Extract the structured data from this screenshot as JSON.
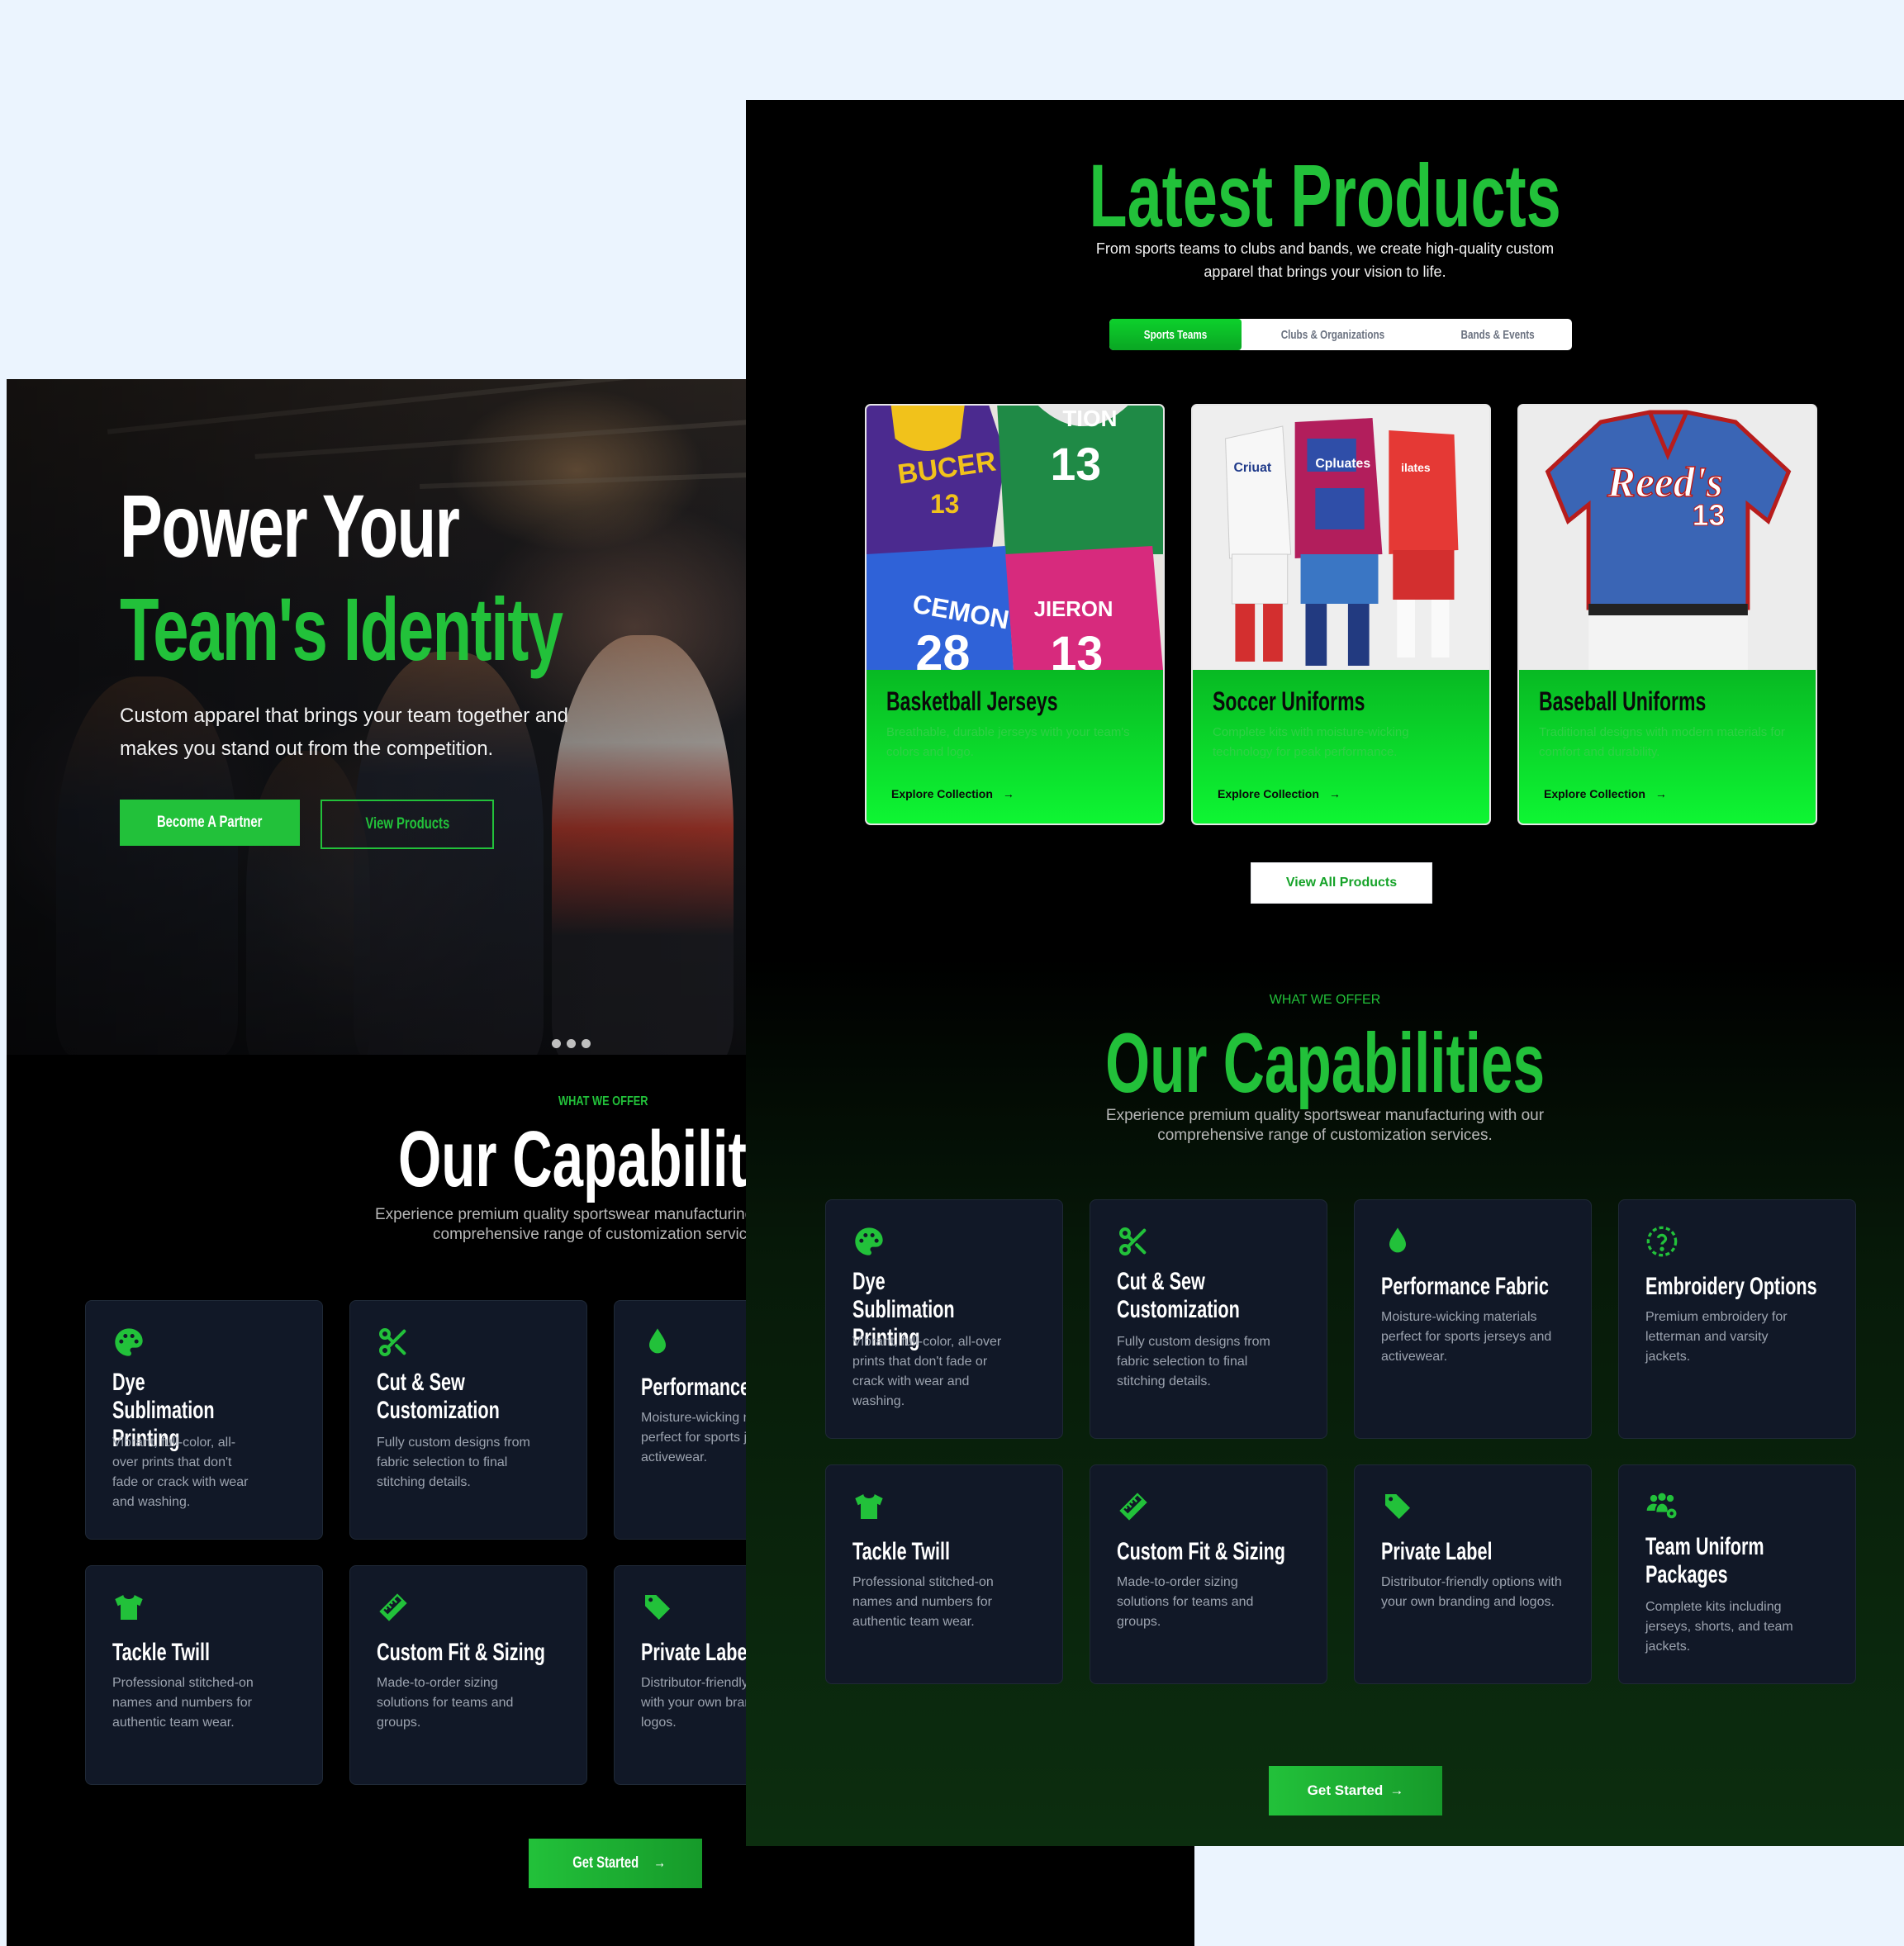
{
  "hero": {
    "title_line1": "Power Your",
    "title_line2": "Team's Identity",
    "subtitle": "Custom apparel that brings your team together and makes you stand out from the competition.",
    "primary_button": "Become A Partner",
    "secondary_button": "View Products",
    "carousel_dots": 3
  },
  "products": {
    "title": "Latest Products",
    "subtitle_line1": "From sports teams to clubs and bands, we create high-quality custom",
    "subtitle_line2": "apparel that brings your vision to life.",
    "tabs": [
      {
        "label": "Sports Teams",
        "active": true
      },
      {
        "label": "Clubs & Organizations",
        "active": false
      },
      {
        "label": "Bands & Events",
        "active": false
      }
    ],
    "cards": [
      {
        "title": "Basketball Jerseys",
        "desc": "Breathable, durable jerseys with your team's colors and logo.",
        "link": "Explore Collection"
      },
      {
        "title": "Soccer Uniforms",
        "desc": "Complete kits with moisture-wicking technology for peak performance.",
        "link": "Explore Collection"
      },
      {
        "title": "Baseball Uniforms",
        "desc": "Traditional designs with modern materials for comfort and durability.",
        "link": "Explore Collection"
      }
    ],
    "jersey_text": {
      "basketball": [
        "BUCER",
        "13",
        "TION",
        "13",
        "CEMON",
        "28",
        "JIERON",
        "13"
      ],
      "soccer": [
        "Criuat",
        "Cpluates",
        "ilates"
      ],
      "baseball": [
        "Reed's",
        "13"
      ]
    },
    "view_all": "View All Products"
  },
  "capabilities": {
    "eyebrow": "WHAT WE OFFER",
    "title": "Our Capabilities",
    "desc_line1": "Experience premium quality sportswear manufacturing with our",
    "desc_line2": "comprehensive range of customization services.",
    "items": [
      {
        "title": "Dye Sublimation Printing",
        "desc": "Vibrant, full-color, all-over prints that don't fade or crack with wear and washing.",
        "icon": "palette-icon"
      },
      {
        "title": "Cut & Sew Customization",
        "desc": "Fully custom designs from fabric selection to final stitching details.",
        "icon": "scissors-icon"
      },
      {
        "title": "Performance Fabric",
        "desc": "Moisture-wicking materials perfect for sports jerseys and activewear.",
        "icon": "droplet-icon"
      },
      {
        "title": "Embroidery Options",
        "desc": "Premium embroidery for letterman and varsity jackets.",
        "icon": "question-circle-icon"
      },
      {
        "title": "Tackle Twill",
        "desc": "Professional stitched-on names and numbers for authentic team wear.",
        "icon": "shirt-icon"
      },
      {
        "title": "Custom Fit & Sizing",
        "desc": "Made-to-order sizing solutions for teams and groups.",
        "icon": "ruler-icon"
      },
      {
        "title": "Private Label",
        "desc": "Distributor-friendly options with your own branding and logos.",
        "icon": "tag-icon"
      },
      {
        "title": "Team Uniform Packages",
        "desc": "Complete kits including jerseys, shorts, and team jackets.",
        "icon": "users-gear-icon"
      }
    ],
    "cta": "Get Started"
  },
  "colors": {
    "accent": "#22c13a",
    "card_bg": "#111827",
    "page_bg": "#ebf4fe",
    "product_card_green": "#0ef733"
  }
}
